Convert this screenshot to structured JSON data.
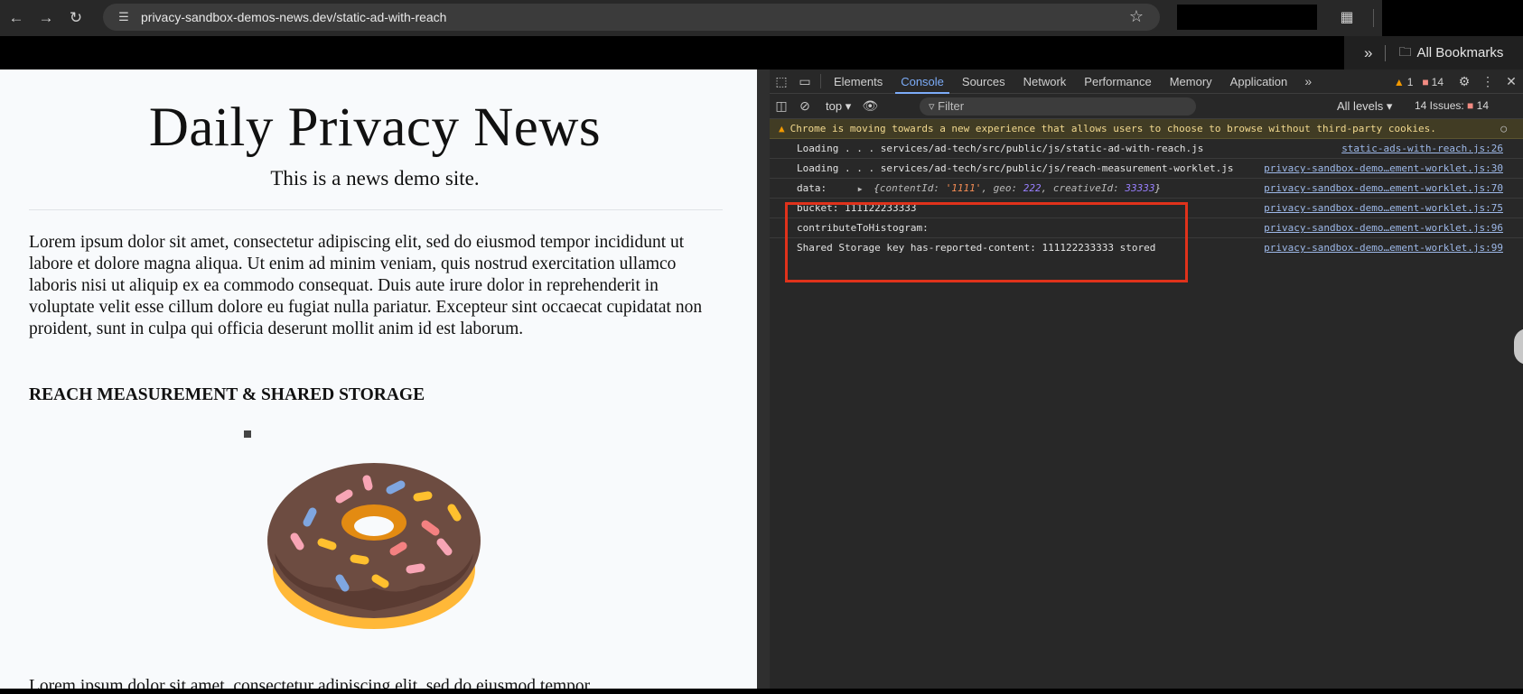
{
  "browser": {
    "url": "privacy-sandbox-demos-news.dev/static-ad-with-reach",
    "bookmarks_label": "All Bookmarks",
    "icons": [
      "back-arrow-icon",
      "forward-arrow-icon",
      "reload-icon",
      "site-info-icon",
      "star-icon",
      "extensions-icon",
      "folder-icon"
    ]
  },
  "page": {
    "title": "Daily Privacy News",
    "subtitle": "This is a news demo site.",
    "paragraph1": "Lorem ipsum dolor sit amet, consectetur adipiscing elit, sed do eiusmod tempor incididunt ut labore et dolore magna aliqua. Ut enim ad minim veniam, quis nostrud exercitation ullamco laboris nisi ut aliquip ex ea commodo consequat. Duis aute irure dolor in reprehenderit in voluptate velit esse cillum dolore eu fugiat nulla pariatur. Excepteur sint occaecat cupidatat non proident, sunt in culpa qui officia deserunt mollit anim id est laborum.",
    "section_heading": "REACH MEASUREMENT & SHARED STORAGE",
    "paragraph2": "Lorem ipsum dolor sit amet, consectetur adipiscing elit, sed do eiusmod tempor"
  },
  "devtools": {
    "tabs": [
      "Elements",
      "Console",
      "Sources",
      "Network",
      "Performance",
      "Memory",
      "Application"
    ],
    "active_tab": "Console",
    "warning_count": "1",
    "issue_count": "14",
    "context": "top",
    "filter_placeholder": "Filter",
    "levels_label": "All levels",
    "issues_label": "14 Issues:",
    "issues_badge_count": "14",
    "banner": "Chrome is moving towards a new experience that allows users to choose to browse without third-party cookies.",
    "logs": [
      {
        "text": "Loading . . . services/ad-tech/src/public/js/static-ad-with-reach.js",
        "source": "static-ads-with-reach.js:26"
      },
      {
        "text": "Loading . . . services/ad-tech/src/public/js/reach-measurement-worklet.js",
        "source": "privacy-sandbox-demo…ement-worklet.js:30"
      },
      {
        "text": "data:",
        "source": "privacy-sandbox-demo…ement-worklet.js:70"
      },
      {
        "text": "bucket: 111122233333",
        "source": "privacy-sandbox-demo…ement-worklet.js:75"
      },
      {
        "text": "contributeToHistogram:",
        "source": "privacy-sandbox-demo…ement-worklet.js:96"
      },
      {
        "text": "Shared Storage key has-reported-content: 111122233333 stored",
        "source": "privacy-sandbox-demo…ement-worklet.js:99"
      }
    ],
    "data_object": {
      "open": "{",
      "k1": "contentId: ",
      "v1": "'1111'",
      "k2": ", geo: ",
      "v2": "222",
      "k3": ", creativeId: ",
      "v3": "33333",
      "close": "}"
    },
    "highlight_color": "#e0321b"
  },
  "colors": {
    "devtools_bg": "#282828",
    "accent": "#7cacf8",
    "page_bg": "#f8fafc"
  }
}
